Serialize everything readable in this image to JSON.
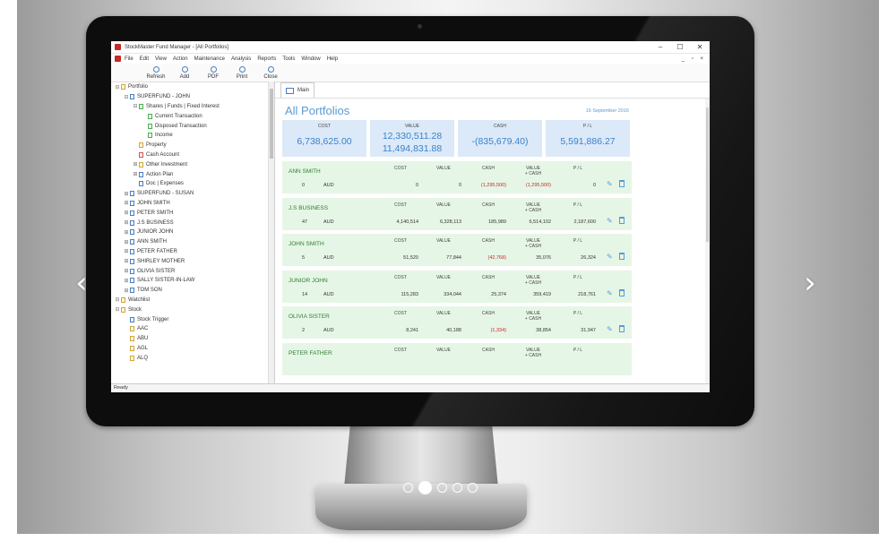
{
  "window": {
    "title": "StockMaster Fund Manager - [All Portfolios]",
    "controls": [
      "–",
      "☐",
      "✕"
    ],
    "mdi_controls": "_ ▫ ×"
  },
  "menu": [
    "File",
    "Edit",
    "View",
    "Action",
    "Maintenance",
    "Analysis",
    "Reports",
    "Tools",
    "Window",
    "Help"
  ],
  "toolbar": {
    "refresh": "Refresh",
    "add": "Add",
    "pdf": "PDF",
    "print": "Print",
    "close": "Close"
  },
  "tree": [
    {
      "label": "Portfolio",
      "indent": 0,
      "toggle": "⊟",
      "icon": "gold"
    },
    {
      "label": "SUPERFUND - JOHN",
      "indent": 1,
      "toggle": "⊟",
      "icon": "blue"
    },
    {
      "label": "Shares | Funds | Fixed Interest",
      "indent": 2,
      "toggle": "⊟",
      "icon": "green"
    },
    {
      "label": "Current Transaction",
      "indent": 3,
      "toggle": "",
      "icon": "green"
    },
    {
      "label": "Disposed Transaction",
      "indent": 3,
      "toggle": "",
      "icon": "green"
    },
    {
      "label": "Income",
      "indent": 3,
      "toggle": "",
      "icon": "green"
    },
    {
      "label": "Property",
      "indent": 2,
      "toggle": "",
      "icon": "gold"
    },
    {
      "label": "Cash Account",
      "indent": 2,
      "toggle": "",
      "icon": "red"
    },
    {
      "label": "Other Investment",
      "indent": 2,
      "toggle": "⊞",
      "icon": "gold"
    },
    {
      "label": "Action Plan",
      "indent": 2,
      "toggle": "⊞",
      "icon": "blue"
    },
    {
      "label": "Doc | Expenses",
      "indent": 2,
      "toggle": "",
      "icon": "blue"
    },
    {
      "label": "SUPERFUND - SUSAN",
      "indent": 1,
      "toggle": "⊞",
      "icon": "blue"
    },
    {
      "label": "JOHN SMITH",
      "indent": 1,
      "toggle": "⊞",
      "icon": "blue"
    },
    {
      "label": "PETER SMITH",
      "indent": 1,
      "toggle": "⊞",
      "icon": "blue"
    },
    {
      "label": "J.S BUSINESS",
      "indent": 1,
      "toggle": "⊞",
      "icon": "blue"
    },
    {
      "label": "JUNIOR JOHN",
      "indent": 1,
      "toggle": "⊞",
      "icon": "blue"
    },
    {
      "label": "ANN SMITH",
      "indent": 1,
      "toggle": "⊞",
      "icon": "blue"
    },
    {
      "label": "PETER FATHER",
      "indent": 1,
      "toggle": "⊞",
      "icon": "blue"
    },
    {
      "label": "SHIRLEY MOTHER",
      "indent": 1,
      "toggle": "⊞",
      "icon": "blue"
    },
    {
      "label": "OLIVIA SISTER",
      "indent": 1,
      "toggle": "⊞",
      "icon": "blue"
    },
    {
      "label": "SALLY SISTER-IN-LAW",
      "indent": 1,
      "toggle": "⊞",
      "icon": "blue"
    },
    {
      "label": "TOM SON",
      "indent": 1,
      "toggle": "⊞",
      "icon": "blue"
    },
    {
      "label": "Watchlist",
      "indent": 0,
      "toggle": "⊟",
      "icon": "gold"
    },
    {
      "label": "Stock",
      "indent": 0,
      "toggle": "⊟",
      "icon": "gold"
    },
    {
      "label": "Stock Trigger",
      "indent": 1,
      "toggle": "",
      "icon": "blue"
    },
    {
      "label": "AAC",
      "indent": 1,
      "toggle": "",
      "icon": "gold"
    },
    {
      "label": "ABU",
      "indent": 1,
      "toggle": "",
      "icon": "gold"
    },
    {
      "label": "AGL",
      "indent": 1,
      "toggle": "",
      "icon": "gold"
    },
    {
      "label": "ALQ",
      "indent": 1,
      "toggle": "",
      "icon": "gold"
    }
  ],
  "tab": {
    "label": "Main"
  },
  "page": {
    "title": "All Portfolios",
    "date": "16 September 2016"
  },
  "summary": [
    {
      "label": "COST",
      "value": "6,738,625.00"
    },
    {
      "label": "VALUE",
      "value": "12,330,511.28",
      "value2": "11,494,831.88"
    },
    {
      "label": "CASH",
      "value": "-(835,679.40)"
    },
    {
      "label": "P / L",
      "value": "5,591,886.27"
    }
  ],
  "card_headers": {
    "cost": "COST",
    "value": "VALUE",
    "cash": "CASH",
    "value_cash": "VALUE\n+ CASH",
    "pl": "P / L"
  },
  "portfolios": [
    {
      "name": "ANN SMITH",
      "count": "0",
      "currency": "AUD",
      "cost": "0",
      "value": "0",
      "cash": "(1,295,500)",
      "value_cash": "(1,295,500)",
      "pl": "0",
      "cash_neg": true,
      "vc_neg": true
    },
    {
      "name": "J.S BUSINESS",
      "count": "47",
      "currency": "AUD",
      "cost": "4,140,514",
      "value": "6,328,113",
      "cash": "185,989",
      "value_cash": "6,514,102",
      "pl": "2,187,600",
      "cash_neg": false,
      "vc_neg": false
    },
    {
      "name": "JOHN SMITH",
      "count": "5",
      "currency": "AUD",
      "cost": "51,520",
      "value": "77,844",
      "cash": "(42,768)",
      "value_cash": "35,076",
      "pl": "26,324",
      "cash_neg": true,
      "vc_neg": false
    },
    {
      "name": "JUNIOR JOHN",
      "count": "14",
      "currency": "AUD",
      "cost": "115,283",
      "value": "334,044",
      "cash": "25,374",
      "value_cash": "359,419",
      "pl": "218,761",
      "cash_neg": false,
      "vc_neg": false
    },
    {
      "name": "OLIVIA SISTER",
      "count": "2",
      "currency": "AUD",
      "cost": "8,241",
      "value": "40,188",
      "cash": "(1,334)",
      "value_cash": "38,854",
      "pl": "31,947",
      "cash_neg": true,
      "vc_neg": false
    },
    {
      "name": "PETER FATHER",
      "count": "",
      "currency": "",
      "cost": "",
      "value": "",
      "cash": "",
      "value_cash": "",
      "pl": "",
      "cash_neg": false,
      "vc_neg": false
    }
  ],
  "status": "Ready",
  "colors": {
    "accent": "#5a9bd5",
    "card_bg": "#e6f6e6",
    "negative": "#c62828",
    "summary_bg": "#dbe9f8"
  }
}
